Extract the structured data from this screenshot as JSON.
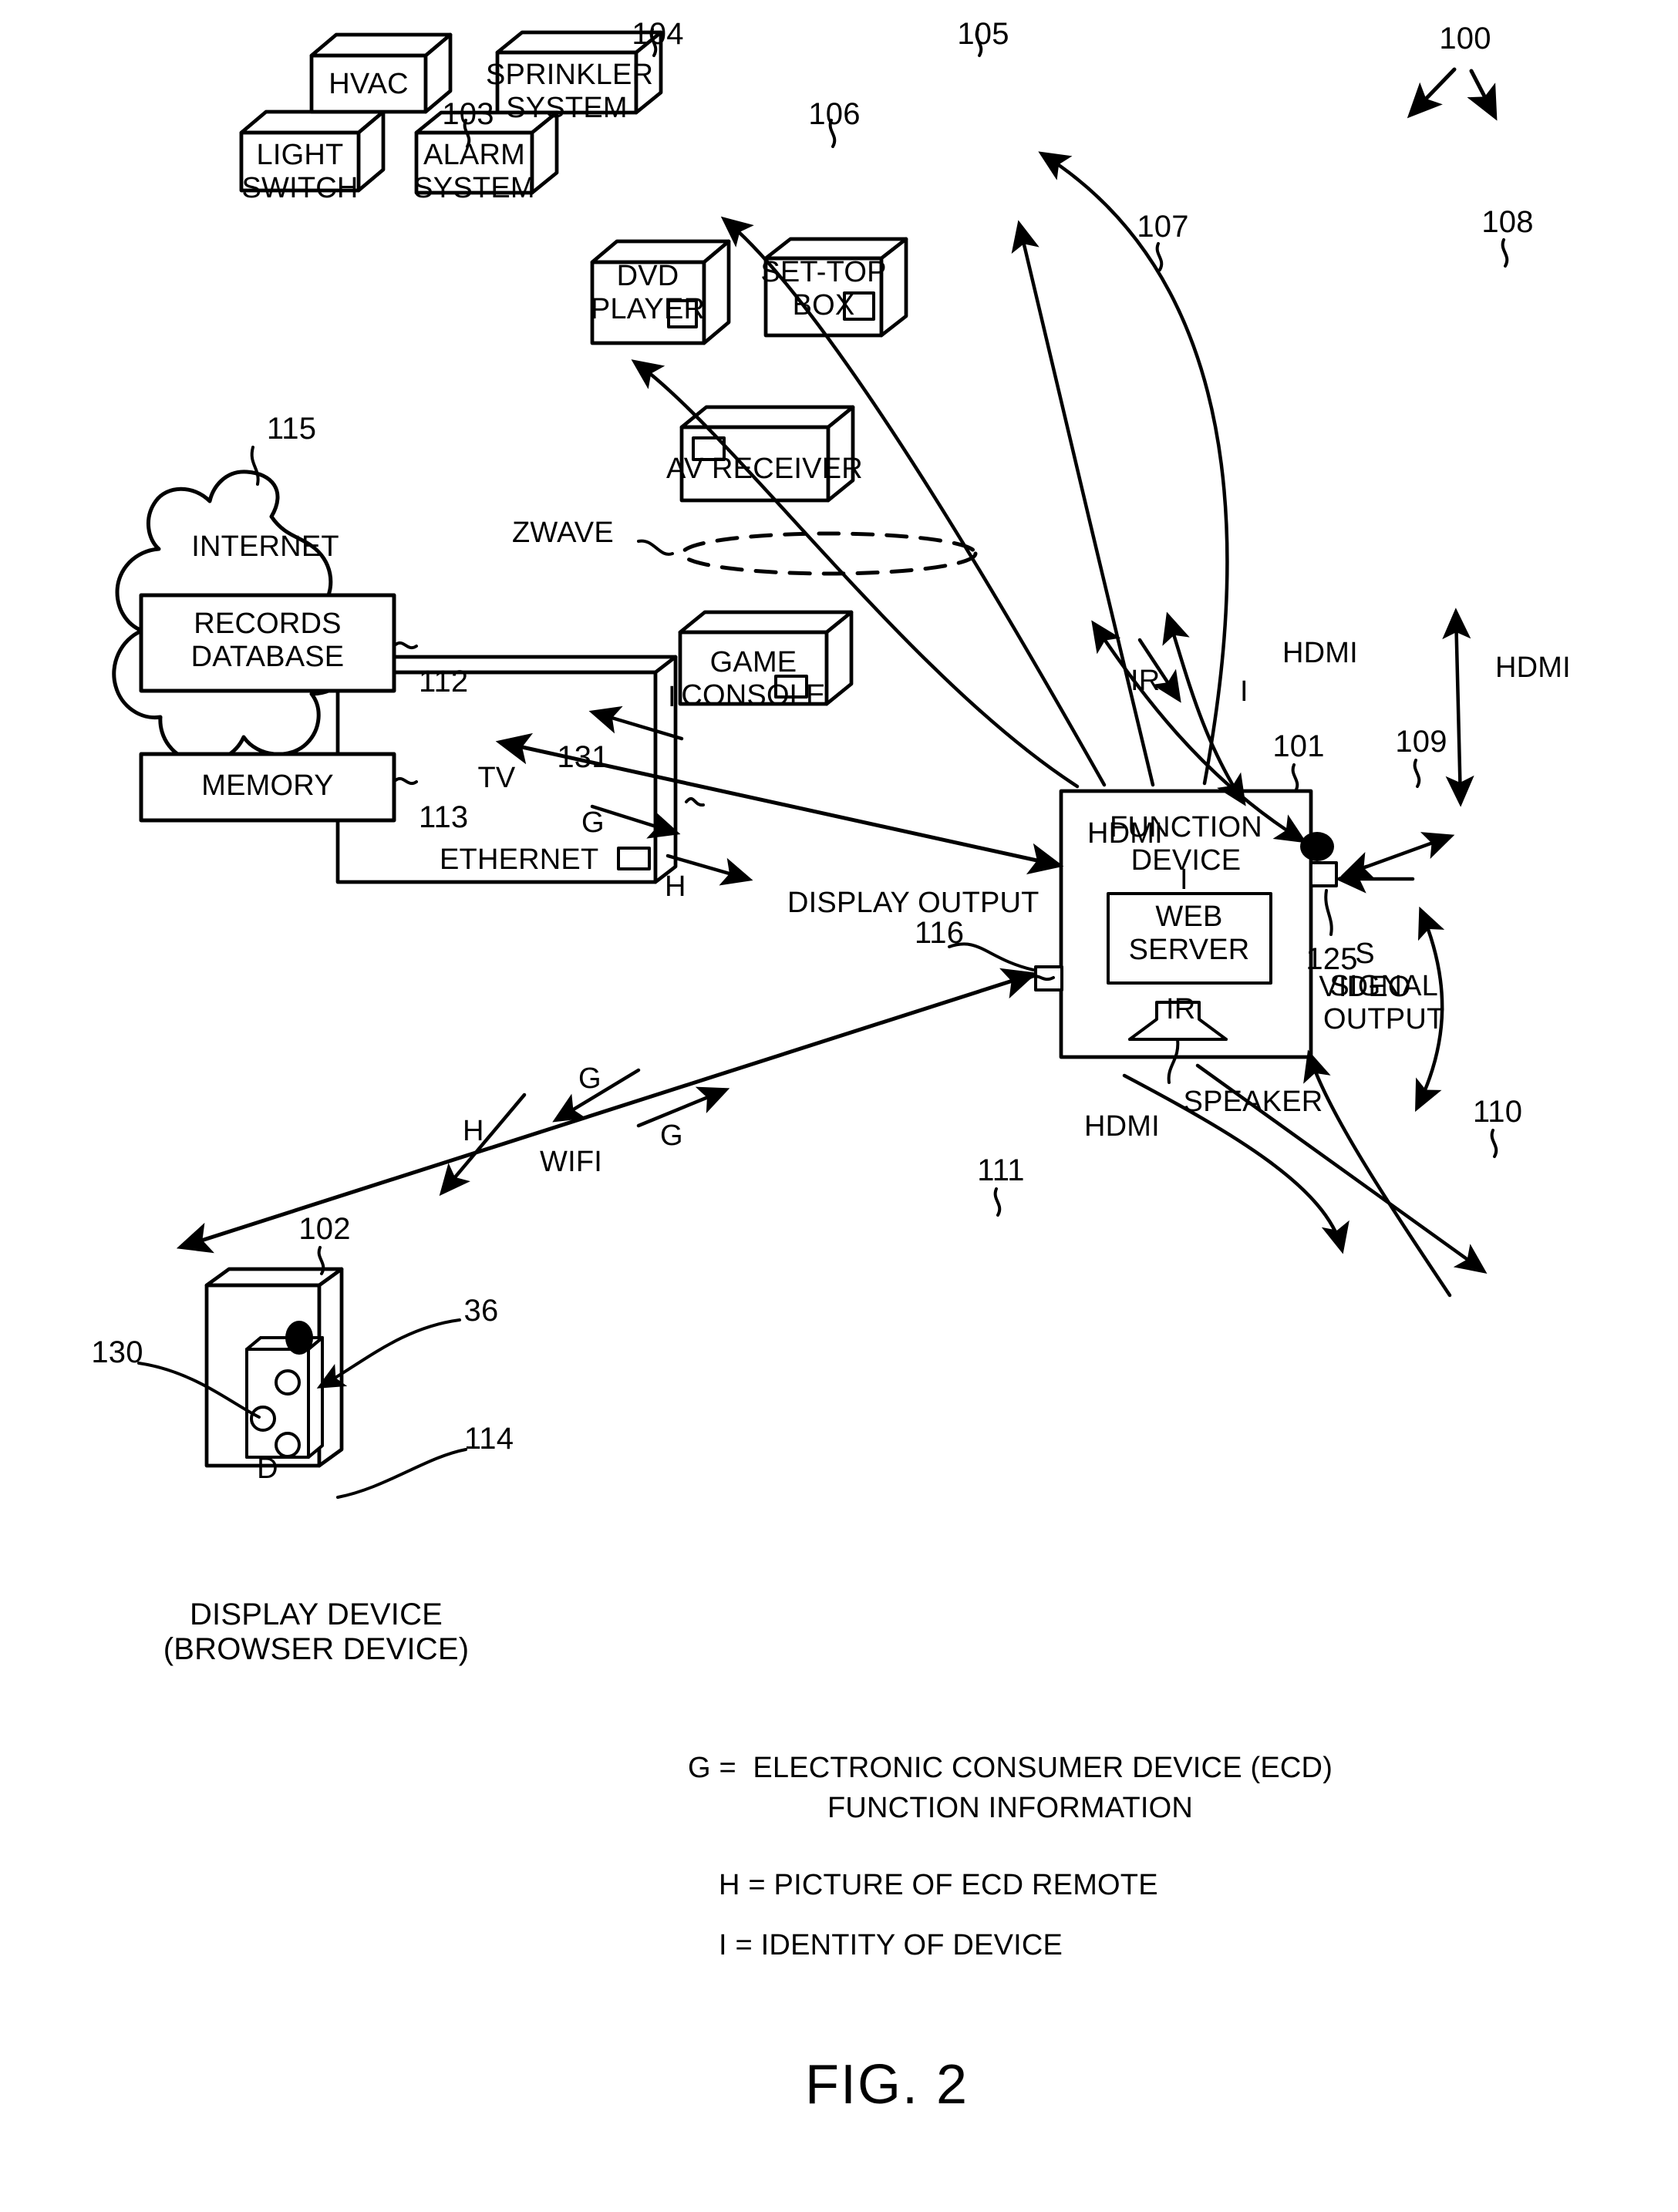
{
  "figure": {
    "caption": "FIG. 2",
    "system_ref": "100"
  },
  "devices": [
    {
      "id": "light_switch",
      "label": "LIGHT\nSWITCH",
      "ref": "103"
    },
    {
      "id": "hvac",
      "label": "HVAC",
      "ref": "104"
    },
    {
      "id": "sprinkler",
      "label": "SPRINKLER\nSYSTEM",
      "ref": "105"
    },
    {
      "id": "alarm",
      "label": "ALARM\nSYSTEM",
      "ref": "106"
    },
    {
      "id": "dvd_player",
      "label": "DVD\nPLAYER",
      "ref": "107"
    },
    {
      "id": "set_top_box",
      "label": "SET-TOP\nBOX",
      "ref": "108"
    },
    {
      "id": "av_receiver",
      "label": "AV RECEIVER",
      "ref": "109"
    },
    {
      "id": "game_console",
      "label": "GAME\nCONSOLE",
      "ref": "110"
    },
    {
      "id": "tv",
      "label": "TV",
      "ref": "111"
    },
    {
      "id": "function_device",
      "label": "FUNCTION\nDEVICE",
      "ref": "101"
    },
    {
      "id": "display_device",
      "label": "D",
      "ref": "102"
    }
  ],
  "internet": {
    "label": "INTERNET",
    "ref": "115",
    "records_database": {
      "label": "RECORDS\nDATABASE",
      "ref": "112"
    },
    "memory": {
      "label": "MEMORY",
      "ref": "113"
    }
  },
  "function_device": {
    "title": "FUNCTION\nDEVICE",
    "ref": "101",
    "web_server": "WEB\nSERVER",
    "speaker": "SPEAKER",
    "signal_output": {
      "label": "SIGNAL\nOUTPUT",
      "ref": "125"
    },
    "display_output": {
      "label": "DISPLAY OUTPUT",
      "ref": "116"
    }
  },
  "display_device": {
    "caption": "DISPLAY DEVICE\n(BROWSER DEVICE)",
    "ref": "102",
    "screen_label": "D",
    "remote_ref": "36",
    "button_ref": "130",
    "body_ref": "114"
  },
  "connections": {
    "zwave": "ZWAVE",
    "ethernet": "ETHERNET",
    "ethernet_ref": "131",
    "wifi": "WIFI",
    "ir_dvd": "IR",
    "ir_av": "IR",
    "hdmi_dvd_av": "HDMI",
    "hdmi_stb_av": "HDMI",
    "hdmi_fd_av": "HDMI",
    "hdmi_fd_tv": "HDMI",
    "s_video": "S\nVIDEO"
  },
  "signals": {
    "ethernet_I": "I",
    "ethernet_G": "G",
    "ethernet_H": "H",
    "wifi_G_out": "G",
    "wifi_G_in": "G",
    "wifi_H": "H",
    "dvd_I": "I",
    "av_I": "I"
  },
  "legend": [
    {
      "key": "G = ",
      "text": "ELECTRONIC CONSUMER DEVICE (ECD)\nFUNCTION INFORMATION"
    },
    {
      "key": "H = ",
      "text": "PICTURE OF ECD REMOTE"
    },
    {
      "key": "I = ",
      "text": "IDENTITY OF DEVICE"
    }
  ],
  "legend_lines": [
    "G =  ELECTRONIC CONSUMER DEVICE (ECD)",
    "FUNCTION INFORMATION",
    "H = PICTURE OF ECD REMOTE",
    "I = IDENTITY OF DEVICE"
  ],
  "colors": {
    "ink": "#000000",
    "paper": "#ffffff"
  }
}
